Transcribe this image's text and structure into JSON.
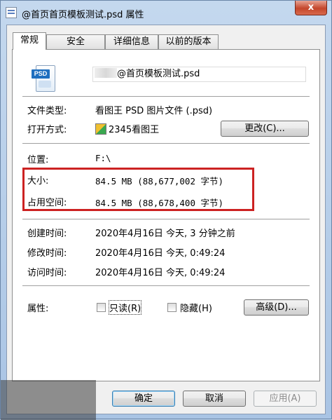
{
  "window": {
    "title": "@首页首页模板测试.psd 属性",
    "close_label": "x"
  },
  "tabs": [
    {
      "label": "常规",
      "active": true
    },
    {
      "label": "安全",
      "active": false
    },
    {
      "label": "详细信息",
      "active": false
    },
    {
      "label": "以前的版本",
      "active": false
    }
  ],
  "file": {
    "icon_text": "PSD",
    "name": "@首页模板测试.psd"
  },
  "general": {
    "type_label": "文件类型:",
    "type_value": "看图王 PSD 图片文件 (.psd)",
    "open_label": "打开方式:",
    "open_value": "2345看图王",
    "change_button": "更改(C)...",
    "location_label": "位置:",
    "location_value": "F:\\",
    "size_label": "大小:",
    "size_value": "84.5 MB (88,677,002 字节)",
    "disk_label": "占用空间:",
    "disk_value": "84.5 MB (88,678,400 字节)",
    "created_label": "创建时间:",
    "created_value": "2020年4月16日 今天, 3 分钟之前",
    "modified_label": "修改时间:",
    "modified_value": "2020年4月16日 今天, 0:49:24",
    "accessed_label": "访问时间:",
    "accessed_value": "2020年4月16日 今天, 0:49:24",
    "attr_label": "属性:",
    "readonly_label": "只读(R)",
    "hidden_label": "隐藏(H)",
    "advanced_button": "高级(D)..."
  },
  "footer": {
    "ok": "确定",
    "cancel": "取消",
    "apply": "应用(A)"
  },
  "colors": {
    "highlight_box": "#cc2222",
    "close_button": "#c4462b"
  }
}
